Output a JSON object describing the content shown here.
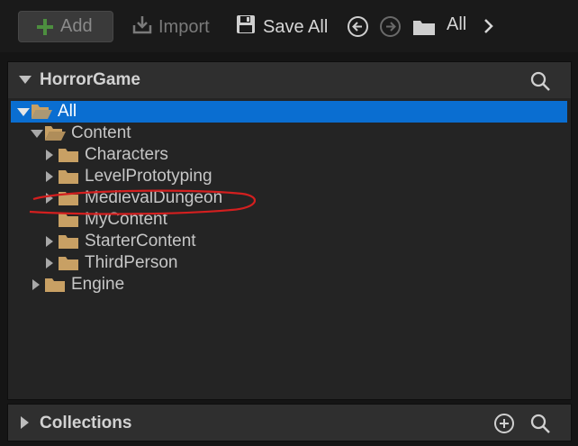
{
  "toolbar": {
    "add_label": "Add",
    "import_label": "Import",
    "save_all_label": "Save All",
    "breadcrumb_label": "All"
  },
  "sources_panel": {
    "title": "HorrorGame"
  },
  "tree": [
    {
      "label": "All",
      "expanded": true,
      "selected": true,
      "has_children": true,
      "icon": "folder-open-icon"
    },
    {
      "label": "Content",
      "expanded": true,
      "selected": false,
      "has_children": true,
      "icon": "folder-open-icon"
    },
    {
      "label": "Characters",
      "expanded": false,
      "selected": false,
      "has_children": true,
      "icon": "folder-icon"
    },
    {
      "label": "LevelPrototyping",
      "expanded": false,
      "selected": false,
      "has_children": true,
      "icon": "folder-icon"
    },
    {
      "label": "MedievalDungeon",
      "expanded": false,
      "selected": false,
      "has_children": true,
      "icon": "folder-icon",
      "highlighted": true
    },
    {
      "label": "MyContent",
      "expanded": false,
      "selected": false,
      "has_children": false,
      "icon": "folder-icon"
    },
    {
      "label": "StarterContent",
      "expanded": false,
      "selected": false,
      "has_children": true,
      "icon": "folder-icon"
    },
    {
      "label": "ThirdPerson",
      "expanded": false,
      "selected": false,
      "has_children": true,
      "icon": "folder-icon"
    },
    {
      "label": "Engine",
      "expanded": false,
      "selected": false,
      "has_children": true,
      "icon": "folder-icon"
    }
  ],
  "collections": {
    "title": "Collections"
  },
  "colors": {
    "selection": "#0a6ed1",
    "folder": "#c8a064",
    "add_plus": "#4d8e3f",
    "annotation": "#d31f1f"
  }
}
